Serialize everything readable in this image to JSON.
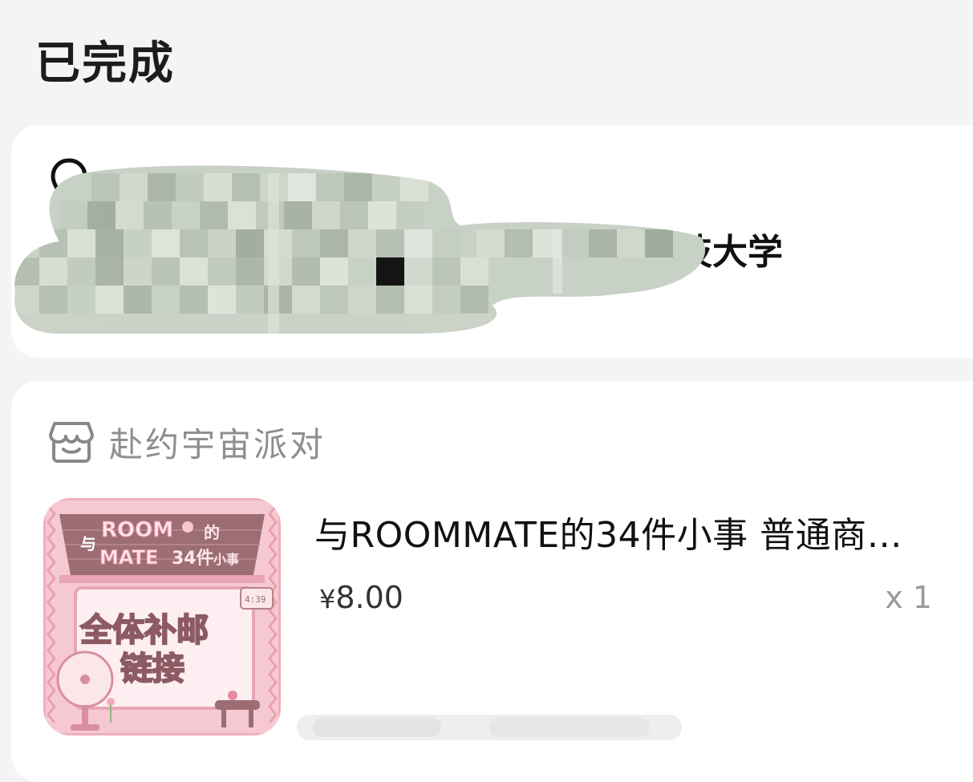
{
  "header": {
    "title": "已完成"
  },
  "address": {
    "visible_tail": "技大学",
    "icon": "location-pin-icon",
    "redacted": true
  },
  "order": {
    "shop_icon": "store-icon",
    "shop_name": "赴约宇宙派对",
    "product": {
      "title": "与ROOMMATE的34件小事 普通商…",
      "currency": "¥",
      "price": "8.00",
      "quantity": "x 1",
      "thumb": {
        "roof_words": [
          "与",
          "ROOM",
          "MATE",
          "的",
          "34件",
          "小事"
        ],
        "line1": "全体补邮",
        "line2": "链接",
        "clock": "4:39",
        "colors": {
          "pink": "#f3b8c4",
          "dark": "#9c6e73",
          "light": "#fbe6ea"
        }
      }
    }
  }
}
